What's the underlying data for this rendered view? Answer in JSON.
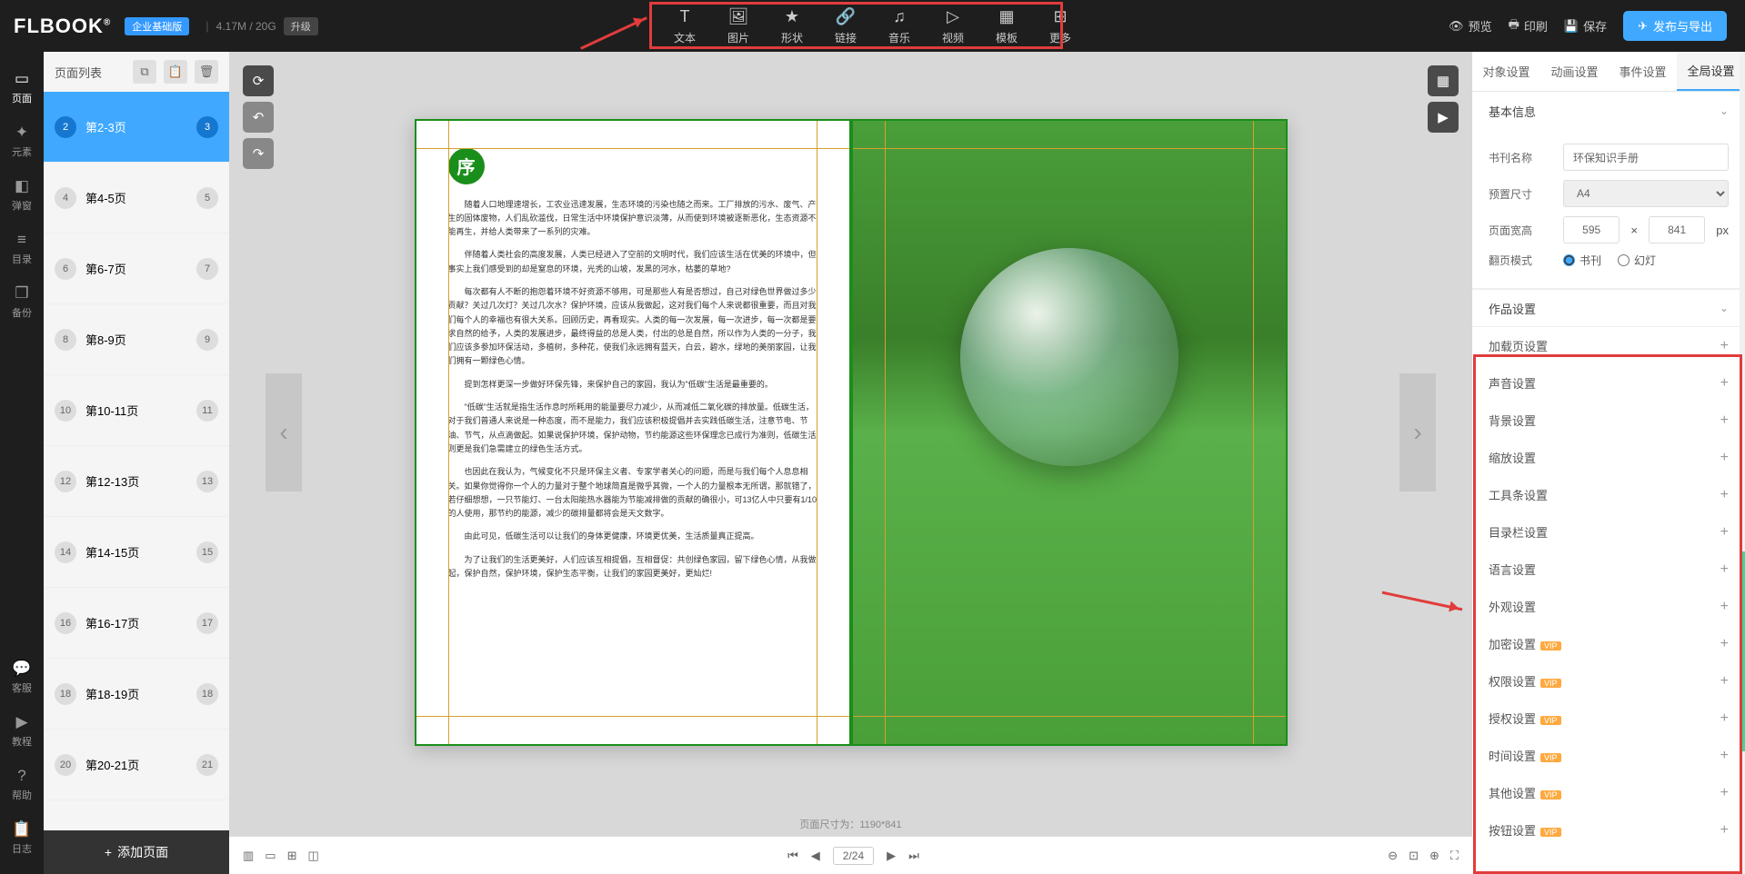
{
  "header": {
    "logo": "FLBOOK",
    "badge": "企业基础版",
    "storage": "4.17M / 20G",
    "upgrade": "升级",
    "toolbar": [
      {
        "icon": "T",
        "label": "文本"
      },
      {
        "icon": "🖼",
        "label": "图片"
      },
      {
        "icon": "★",
        "label": "形状"
      },
      {
        "icon": "🔗",
        "label": "链接"
      },
      {
        "icon": "♫",
        "label": "音乐"
      },
      {
        "icon": "▷",
        "label": "视频"
      },
      {
        "icon": "▦",
        "label": "模板"
      },
      {
        "icon": "⊞",
        "label": "更多"
      }
    ],
    "right": {
      "preview": "预览",
      "print": "印刷",
      "save": "保存",
      "publish": "发布与导出"
    }
  },
  "sidebar_left": {
    "items": [
      {
        "icon": "▭",
        "label": "页面"
      },
      {
        "icon": "✦",
        "label": "元素"
      },
      {
        "icon": "◧",
        "label": "弹窗"
      },
      {
        "icon": "≡",
        "label": "目录"
      },
      {
        "icon": "❒",
        "label": "备份"
      }
    ],
    "bottom": [
      {
        "icon": "💬",
        "label": "客服"
      },
      {
        "icon": "▶",
        "label": "教程"
      },
      {
        "icon": "?",
        "label": "帮助"
      },
      {
        "icon": "📋",
        "label": "日志"
      }
    ]
  },
  "page_panel": {
    "title": "页面列表",
    "items": [
      {
        "num_l": "2",
        "label": "第2-3页",
        "num_r": "3",
        "active": true
      },
      {
        "num_l": "4",
        "label": "第4-5页",
        "num_r": "5"
      },
      {
        "num_l": "6",
        "label": "第6-7页",
        "num_r": "7"
      },
      {
        "num_l": "8",
        "label": "第8-9页",
        "num_r": "9"
      },
      {
        "num_l": "10",
        "label": "第10-11页",
        "num_r": "11"
      },
      {
        "num_l": "12",
        "label": "第12-13页",
        "num_r": "13"
      },
      {
        "num_l": "14",
        "label": "第14-15页",
        "num_r": "15"
      },
      {
        "num_l": "16",
        "label": "第16-17页",
        "num_r": "17"
      },
      {
        "num_l": "18",
        "label": "第18-19页",
        "num_r": "18"
      },
      {
        "num_l": "20",
        "label": "第20-21页",
        "num_r": "21"
      }
    ],
    "add": "添加页面"
  },
  "canvas": {
    "seq": "序",
    "paragraphs": [
      "随着人口地理速增长，工农业迅速发展，生态环境的污染也随之而来。工厂排放的污水、废气、产生的固体废物，人们乱砍滥伐，日常生活中环境保护意识淡薄，从而使到环境被逐新恶化，生态资源不能再生，并给人类带来了一系列的灾难。",
      "伴随着人类社会的高度发展，人类已经进入了空前的文明时代，我们应该生活在优美的环境中，但事实上我们感受到的却是窒息的环境，光秃的山坡，发黑的河水，枯萎的草地?",
      "每次都有人不断的抱怨着环境不好资源不够用，可是那些人有是否想过，自己对绿色世界做过多少贡献？关过几次灯？关过几次水？保护环境，应该从我做起，这对我们每个人来说都很重要，而且对我们每个人的幸福也有很大关系。回顾历史，再看现实。人类的每一次发展，每一次进步，每一次都是要求自然的给予，人类的发展进步，最终得益的总是人类，付出的总是自然，所以作为人类的一分子，我们应该多参加环保活动，多植树，多种花，使我们永远拥有蓝天，白云，碧水，绿地的美丽家园，让我们拥有一颗绿色心情。",
      "提到怎样更深一步做好环保先锋，来保护自己的家园，我认为\"低碳\"生活是最重要的。",
      "\"低碳\"生活就是指生活作息时所耗用的能量要尽力减少，从而减低二氧化碳的排放量。低碳生活，对于我们普通人来说是一种态度，而不是能力，我们应该积极提倡并去实践低碳生活，注意节电、节油、节气，从点滴做起。如果说保护环境，保护动物，节约能源这些环保理念已成行为准则，低碳生活则更是我们急需建立的绿色生活方式。",
      "也因此在我认为，气候变化不只是环保主义者、专家学者关心的问题，而是与我们每个人息息相关。如果你觉得你一个人的力量对于整个地球简直是微乎其微，一个人的力量根本无所谓，那就错了，若仔细想想，一只节能灯、一台太阳能热水器能为节能减排做的贡献的确很小，可13亿人中只要有1/10的人使用，那节约的能源，减少的碳排量都将会是天文数字。",
      "由此可见，低碳生活可以让我们的身体更健康，环境更优美，生活质量真正提高。",
      "为了让我们的生活更美好，人们应该互相提倡，互相督促：共创绿色家园，留下绿色心情，从我做起，保护自然，保护环境，保护生态平衡，让我们的家园更美好，更灿烂!"
    ],
    "dimensions": "页面尺寸为：1190*841",
    "page_indicator": "2/24"
  },
  "right_panel": {
    "tabs": [
      "对象设置",
      "动画设置",
      "事件设置",
      "全局设置"
    ],
    "basic": {
      "title": "基本信息",
      "book_name_label": "书刊名称",
      "book_name_value": "环保知识手册",
      "preset_label": "预置尺寸",
      "preset_value": "A4",
      "page_width_label": "页面宽高",
      "width": "595",
      "height": "841",
      "unit": "px",
      "mode_label": "翻页模式",
      "mode_book": "书刊",
      "mode_slide": "幻灯"
    },
    "work_settings_title": "作品设置",
    "settings": [
      {
        "label": "加载页设置"
      },
      {
        "label": "声音设置"
      },
      {
        "label": "背景设置"
      },
      {
        "label": "缩放设置"
      },
      {
        "label": "工具条设置"
      },
      {
        "label": "目录栏设置"
      },
      {
        "label": "语言设置"
      },
      {
        "label": "外观设置"
      },
      {
        "label": "加密设置",
        "vip": true
      },
      {
        "label": "权限设置",
        "vip": true
      },
      {
        "label": "授权设置",
        "vip": true
      },
      {
        "label": "时间设置",
        "vip": true
      },
      {
        "label": "其他设置",
        "vip": true
      },
      {
        "label": "按钮设置",
        "vip": true
      }
    ]
  }
}
